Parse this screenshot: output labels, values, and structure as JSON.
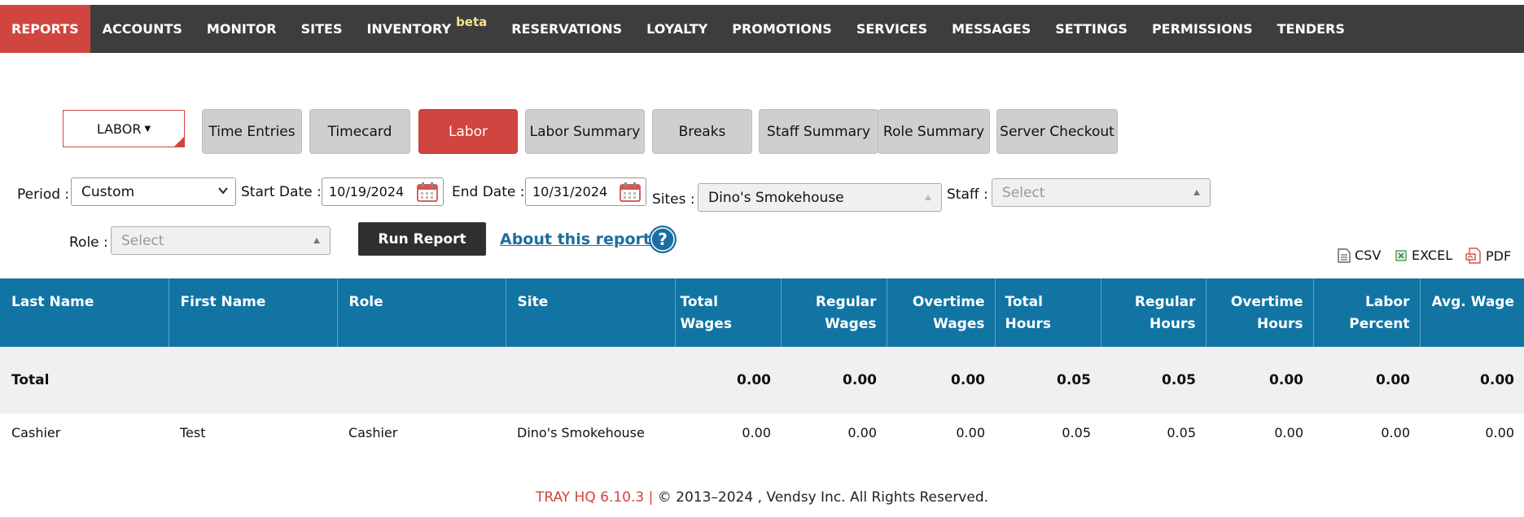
{
  "nav": {
    "items": [
      {
        "label": "REPORTS",
        "active": true
      },
      {
        "label": "ACCOUNTS"
      },
      {
        "label": "MONITOR"
      },
      {
        "label": "SITES"
      },
      {
        "label": "INVENTORY",
        "badge": "beta"
      },
      {
        "label": "RESERVATIONS"
      },
      {
        "label": "LOYALTY"
      },
      {
        "label": "PROMOTIONS"
      },
      {
        "label": "SERVICES"
      },
      {
        "label": "MESSAGES"
      },
      {
        "label": "SETTINGS"
      },
      {
        "label": "PERMISSIONS"
      },
      {
        "label": "TENDERS"
      }
    ]
  },
  "report_type": {
    "label": "LABOR"
  },
  "tabs": [
    {
      "label": "Time Entries"
    },
    {
      "label": "Timecard"
    },
    {
      "label": "Labor",
      "active": true
    },
    {
      "label": "Labor Summary"
    },
    {
      "label": "Breaks"
    },
    {
      "label": "Staff Summary"
    },
    {
      "label": "Role Summary"
    },
    {
      "label": "Server Checkout"
    }
  ],
  "filters": {
    "period_label": "Period :",
    "period_value": "Custom",
    "start_label": "Start Date :",
    "start_value": "10/19/2024",
    "end_label": "End Date :",
    "end_value": "10/31/2024",
    "sites_label": "Sites :",
    "sites_value": "Dino's Smokehouse",
    "staff_label": "Staff :",
    "staff_placeholder": "Select",
    "role_label": "Role :",
    "role_placeholder": "Select"
  },
  "actions": {
    "run_report": "Run Report",
    "about": "About this report",
    "help_glyph": "?"
  },
  "exports": {
    "csv": "CSV",
    "excel": "EXCEL",
    "pdf": "PDF"
  },
  "table": {
    "columns": [
      [
        "Last Name"
      ],
      [
        "First Name"
      ],
      [
        "Role"
      ],
      [
        "Site"
      ],
      [
        "Total Wages"
      ],
      [
        "Regular",
        "Wages"
      ],
      [
        "Overtime",
        "Wages"
      ],
      [
        "Total Hours"
      ],
      [
        "Regular",
        "Hours"
      ],
      [
        "Overtime",
        "Hours"
      ],
      [
        "Labor",
        "Percent"
      ],
      [
        "Avg. Wage"
      ]
    ],
    "total": {
      "label": "Total",
      "values": [
        "0.00",
        "0.00",
        "0.00",
        "0.05",
        "0.05",
        "0.00",
        "0.00",
        "0.00"
      ]
    },
    "rows": [
      {
        "last_name": "Cashier",
        "first_name": "Test",
        "role": "Cashier",
        "site": "Dino's Smokehouse",
        "values": [
          "0.00",
          "0.00",
          "0.00",
          "0.05",
          "0.05",
          "0.00",
          "0.00",
          "0.00"
        ]
      }
    ]
  },
  "footer": {
    "version": "TRAY HQ 6.10.3 |",
    "copyright": "© 2013–2024 , Vendsy Inc. All Rights Reserved."
  },
  "colors": {
    "nav_bg": "#3d3d3d",
    "accent_red": "#d0453f",
    "table_header": "#1174a3",
    "link_blue": "#1b6fa0"
  }
}
